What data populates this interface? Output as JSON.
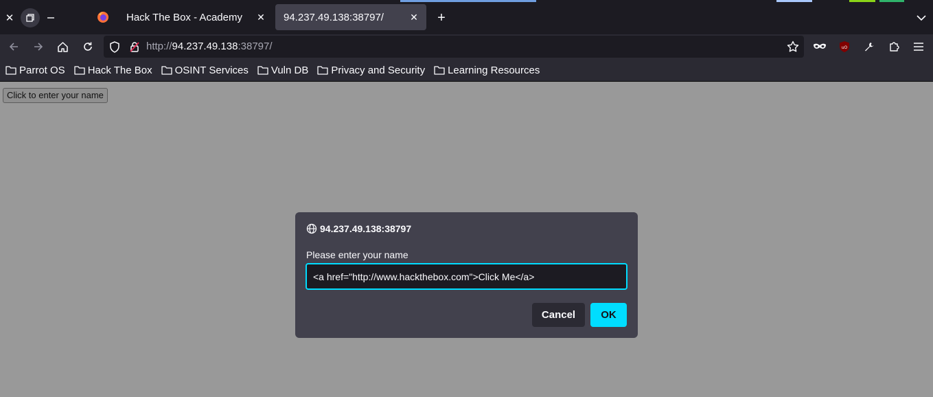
{
  "browser": {
    "tabs": [
      {
        "title": "Hack The Box - Academy",
        "active": false
      },
      {
        "title": "94.237.49.138:38797/",
        "active": true
      }
    ],
    "url": {
      "scheme": "http://",
      "host": "94.237.49.138",
      "port": ":38797/"
    },
    "bookmarks": [
      "Parrot OS",
      "Hack The Box",
      "OSINT Services",
      "Vuln DB",
      "Privacy and Security",
      "Learning Resources"
    ]
  },
  "page": {
    "button_label": "Click to enter your name"
  },
  "dialog": {
    "origin": "94.237.49.138:38797",
    "message": "Please enter your name",
    "input_value": "<a href=\"http://www.hackthebox.com\">Click Me</a>",
    "cancel_label": "Cancel",
    "ok_label": "OK"
  },
  "colors": {
    "accent": "#00ddff",
    "tabstrip": "#1c1b22",
    "toolbar": "#2b2a33",
    "dialog": "#42414d",
    "page_background": "#999999"
  }
}
